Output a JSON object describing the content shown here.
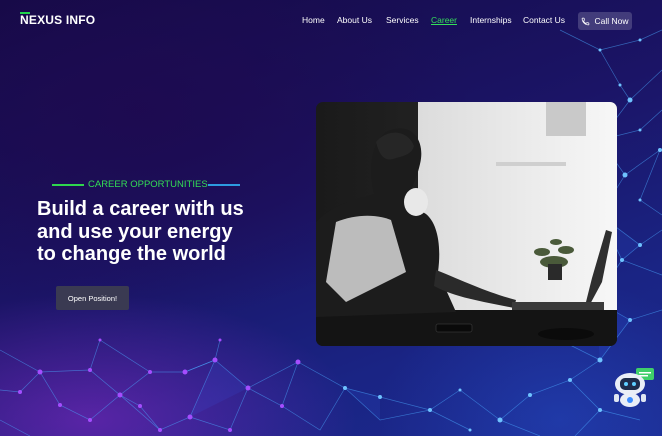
{
  "brand": {
    "name": "NEXUS INFO"
  },
  "nav": {
    "items": [
      {
        "label": "Home",
        "active": false
      },
      {
        "label": "About Us",
        "active": false
      },
      {
        "label": "Services",
        "active": false
      },
      {
        "label": "Career",
        "active": true
      },
      {
        "label": "Internships",
        "active": false
      },
      {
        "label": "Contact Us",
        "active": false
      }
    ],
    "cta": {
      "label": "Call Now",
      "icon": "phone-icon"
    }
  },
  "hero": {
    "eyebrow": "CAREER OPPORTUNITIES",
    "headline": [
      "Build a career with us",
      "and use your energy",
      "to change the world"
    ],
    "button": "Open Position!"
  },
  "colors": {
    "accent_green": "#33dd55",
    "accent_blue": "#2d9be0",
    "background": "#1b1466",
    "button_bg": "#3a3a52"
  },
  "widgets": {
    "chat_bot_icon": "robot-chat-icon"
  }
}
